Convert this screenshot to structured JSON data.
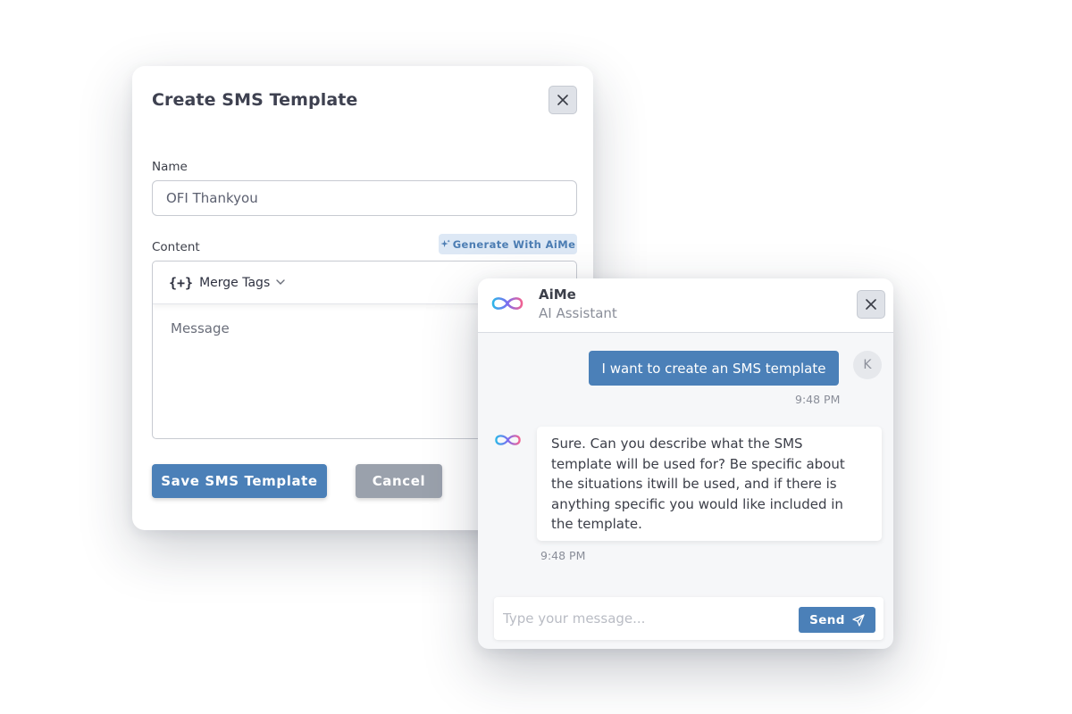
{
  "modal": {
    "title": "Create SMS Template",
    "name_label": "Name",
    "name_value": "OFI Thankyou",
    "content_label": "Content",
    "generate_button": "Generate With AiMe",
    "merge_tags_icon": "{+}",
    "merge_tags_label": "Merge Tags",
    "message_placeholder": "Message",
    "save_button": "Save SMS Template",
    "cancel_button": "Cancel",
    "icons": {
      "close": "close-icon",
      "sparkle": "sparkle-icon",
      "merge": "merge-tags-icon",
      "chevron": "chevron-down-icon"
    }
  },
  "chat": {
    "assistant_name": "AiMe",
    "assistant_role": "AI Assistant",
    "messages": [
      {
        "sender": "user",
        "text": "I want to create an SMS template",
        "time": "9:48 PM",
        "avatar": "K"
      },
      {
        "sender": "assistant",
        "text": "Sure. Can you describe what the SMS template will be used for? Be specific about the situations itwill be used, and if there is anything specific you would like included in the template.",
        "time": "9:48 PM"
      }
    ],
    "input_placeholder": "Type your message...",
    "send_button": "Send",
    "icons": {
      "logo": "infinity-logo-icon",
      "close": "close-icon",
      "send": "send-icon"
    }
  },
  "colors": {
    "primary": "#4b80b8",
    "secondary": "#9aa1ac",
    "accent_light": "#dde8f5",
    "logo_gradient": [
      "#2fb5e8",
      "#7b6cf0",
      "#f06292"
    ]
  }
}
